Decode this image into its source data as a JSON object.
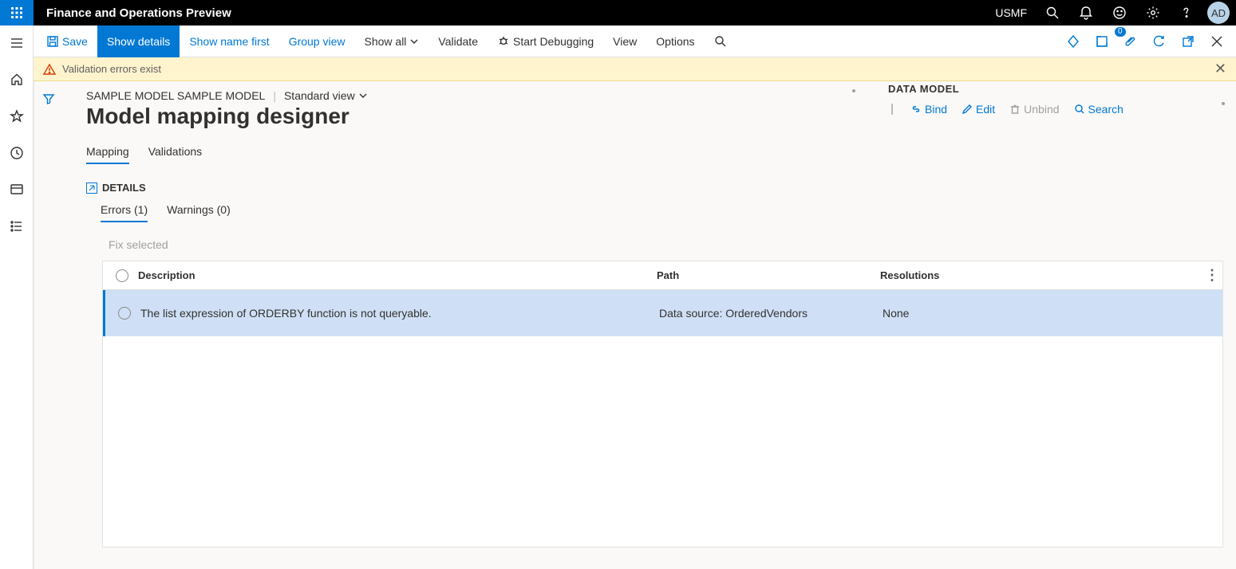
{
  "topbar": {
    "app_title": "Finance and Operations Preview",
    "company": "USMF",
    "avatar": "AD"
  },
  "actionbar": {
    "save": "Save",
    "show_details": "Show details",
    "show_name_first": "Show name first",
    "group_view": "Group view",
    "show_all": "Show all",
    "validate": "Validate",
    "start_debugging": "Start Debugging",
    "view": "View",
    "options": "Options",
    "badge_count": "0"
  },
  "warning": {
    "text": "Validation errors exist"
  },
  "breadcrumb": {
    "model": "SAMPLE MODEL SAMPLE MODEL",
    "view": "Standard view"
  },
  "page_title": "Model mapping designer",
  "tabs": {
    "mapping": "Mapping",
    "validations": "Validations"
  },
  "details": {
    "label": "DETAILS",
    "errors_tab": "Errors (1)",
    "warnings_tab": "Warnings (0)",
    "fix_selected": "Fix selected"
  },
  "grid": {
    "headers": {
      "description": "Description",
      "path": "Path",
      "resolutions": "Resolutions"
    },
    "rows": [
      {
        "description": "The list expression of ORDERBY function is not queryable.",
        "path": "Data source: OrderedVendors",
        "resolutions": "None"
      }
    ]
  },
  "data_model": {
    "title": "DATA MODEL",
    "bind": "Bind",
    "edit": "Edit",
    "unbind": "Unbind",
    "search": "Search"
  }
}
